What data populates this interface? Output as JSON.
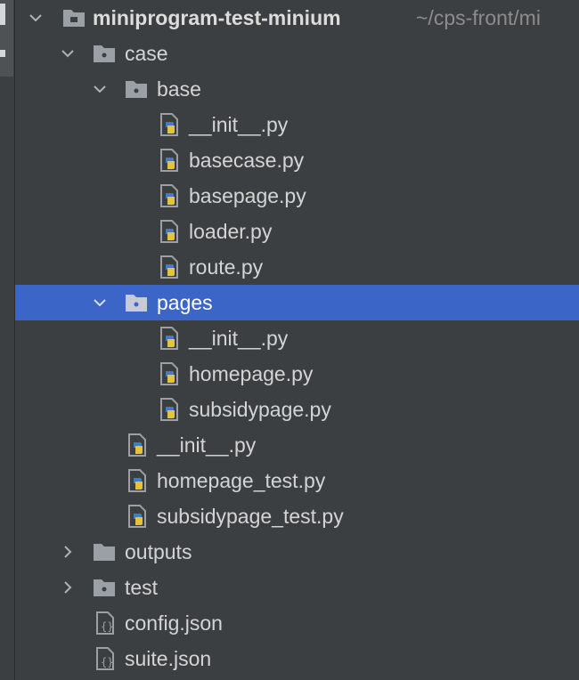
{
  "project": {
    "name": "miniprogram-test-minium",
    "path": "~/cps-front/mi"
  },
  "tree": {
    "case": "case",
    "base": "base",
    "base_files": [
      "__init__.py",
      "basecase.py",
      "basepage.py",
      "loader.py",
      "route.py"
    ],
    "pages": "pages",
    "pages_files": [
      "__init__.py",
      "homepage.py",
      "subsidypage.py"
    ],
    "case_files": [
      "__init__.py",
      "homepage_test.py",
      "subsidypage_test.py"
    ],
    "outputs": "outputs",
    "test": "test",
    "root_files": [
      "config.json",
      "suite.json"
    ]
  },
  "colors": {
    "selection": "#3b65c6",
    "folder": "#9aa0a6",
    "python_blue": "#3f7fc1",
    "python_yellow": "#e5c33a"
  }
}
